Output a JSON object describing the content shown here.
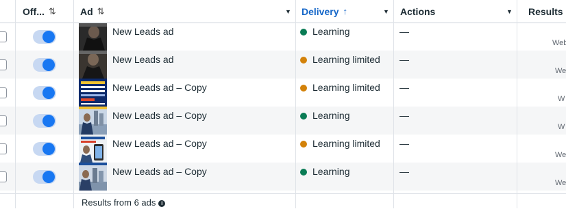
{
  "header": {
    "off_label": "Off...",
    "off_sort": "⇅",
    "ad_label": "Ad",
    "ad_sort": "⇅",
    "delivery_label": "Delivery",
    "delivery_sort": "↑",
    "actions_label": "Actions",
    "results_label": "Results",
    "results_sort": "↑"
  },
  "colors": {
    "learning": "#0a7c55",
    "learning_limited": "#d3820a",
    "delivery_header": "#1466c8",
    "toggle_on": "#1877f2"
  },
  "rows": [
    {
      "name": "New Leads ad",
      "status": "Learning",
      "status_type": "learning",
      "actions": "—",
      "results": "Web",
      "toggle_on": true
    },
    {
      "name": "New Leads ad",
      "status": "Learning limited",
      "status_type": "learning_limited",
      "actions": "—",
      "results": "We",
      "toggle_on": true
    },
    {
      "name": "New Leads ad – Copy",
      "status": "Learning limited",
      "status_type": "learning_limited",
      "actions": "—",
      "results": "W",
      "toggle_on": true
    },
    {
      "name": "New Leads ad – Copy",
      "status": "Learning",
      "status_type": "learning",
      "actions": "—",
      "results": "W",
      "toggle_on": true
    },
    {
      "name": "New Leads ad – Copy",
      "status": "Learning limited",
      "status_type": "learning_limited",
      "actions": "—",
      "results": "We",
      "toggle_on": true
    },
    {
      "name": "New Leads ad – Copy",
      "status": "Learning",
      "status_type": "learning",
      "actions": "—",
      "results": "We",
      "toggle_on": true
    }
  ],
  "footer": {
    "text": "Results from 6 ads",
    "info_icon": "info-icon"
  }
}
